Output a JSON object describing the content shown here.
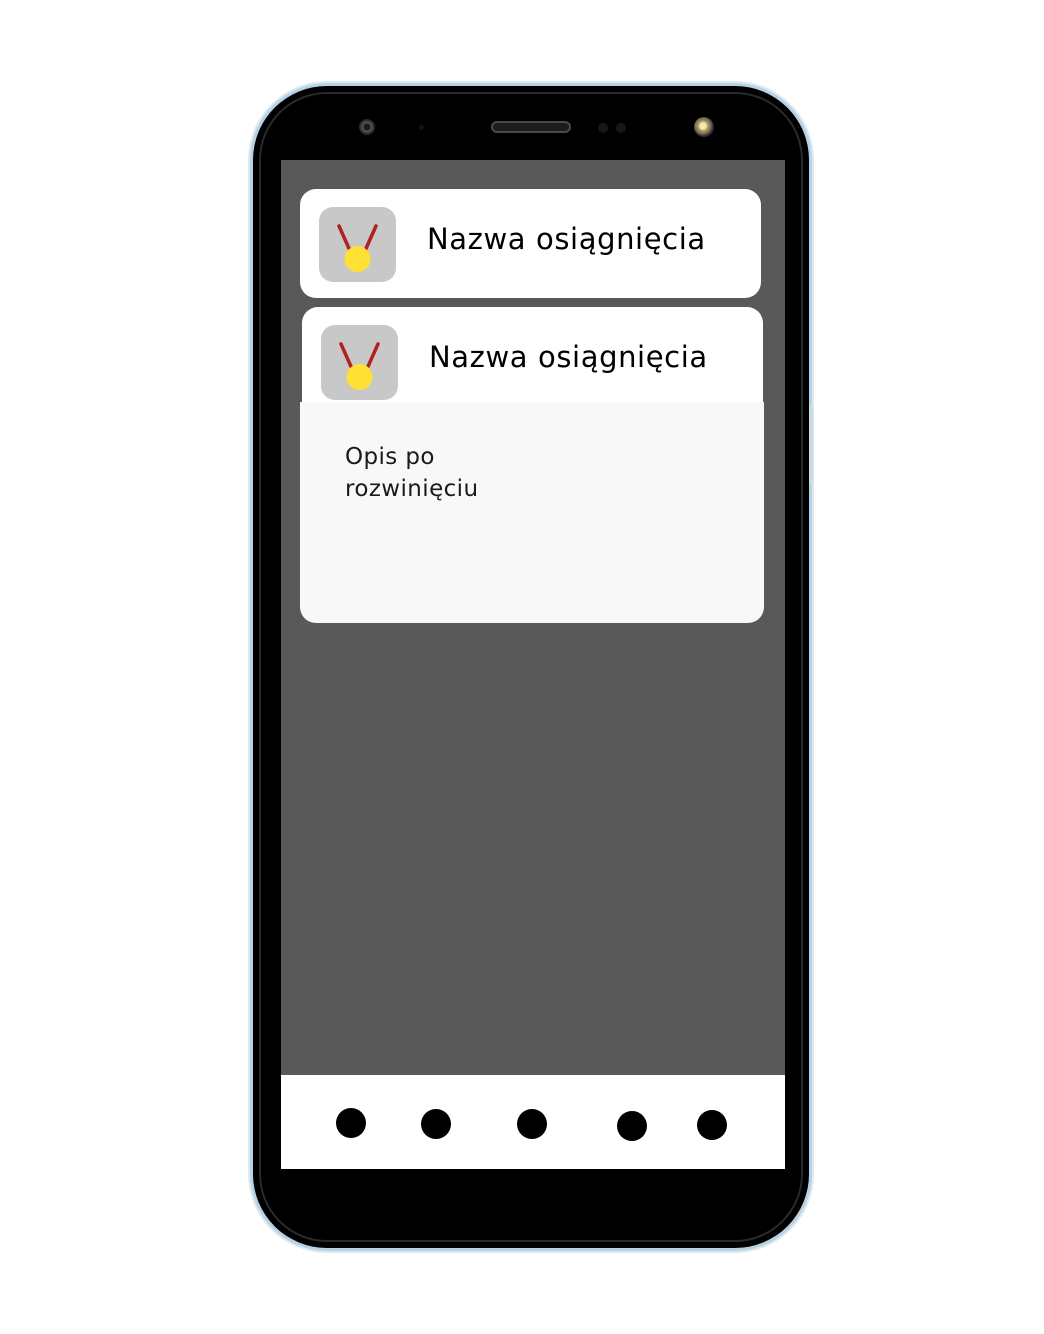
{
  "achievements": [
    {
      "title": "Nazwa osiągnięcia",
      "icon": "medal-icon",
      "expanded": false
    },
    {
      "title": "Nazwa osiągnięcia",
      "icon": "medal-icon",
      "expanded": true,
      "description": "Opis po rozwinięciu"
    }
  ],
  "colors": {
    "screen_background": "#595959",
    "card_background": "#ffffff",
    "expanded_panel_background": "#f8f8f8",
    "icon_tile": "#c8c8c8",
    "medal_ribbon": "#b22020",
    "medal_disc": "#ffe135",
    "nav_dot": "#000000"
  },
  "bottom_nav": {
    "items": [
      "nav-dot-1",
      "nav-dot-2",
      "nav-dot-3",
      "nav-dot-4",
      "nav-dot-5"
    ]
  }
}
